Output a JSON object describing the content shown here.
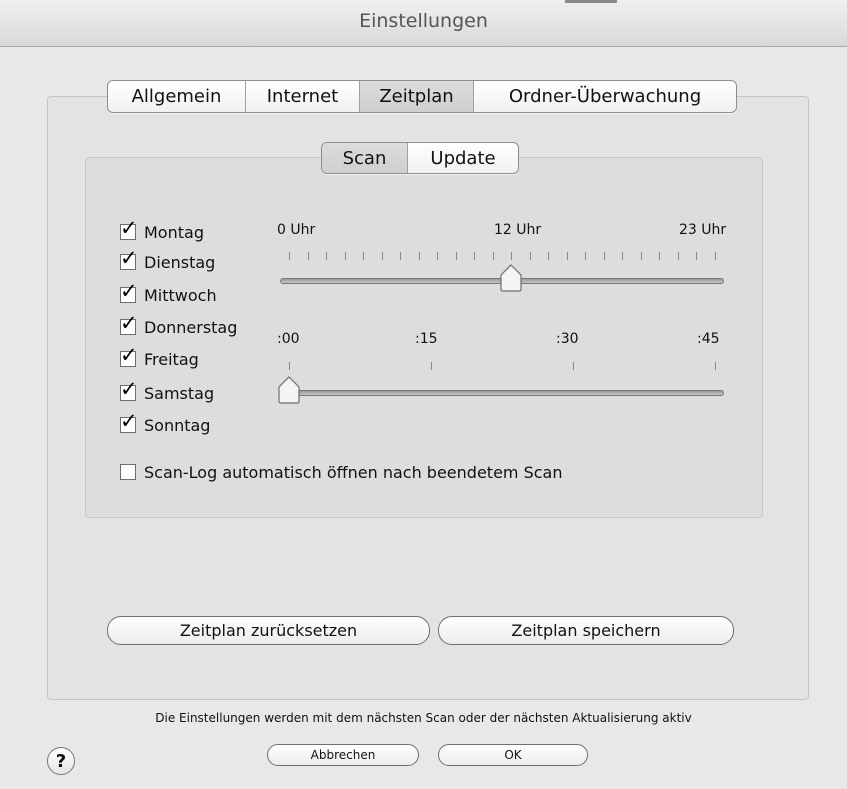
{
  "window": {
    "title": "Einstellungen"
  },
  "main_tabs": [
    {
      "label": "Allgemein",
      "selected": false
    },
    {
      "label": "Internet",
      "selected": false
    },
    {
      "label": "Zeitplan",
      "selected": true
    },
    {
      "label": "Ordner-Überwachung",
      "selected": false
    }
  ],
  "sub_tabs": [
    {
      "label": "Scan",
      "selected": true
    },
    {
      "label": "Update",
      "selected": false
    }
  ],
  "days": [
    {
      "label": "Montag",
      "checked": true
    },
    {
      "label": "Dienstag",
      "checked": true
    },
    {
      "label": "Mittwoch",
      "checked": true
    },
    {
      "label": "Donnerstag",
      "checked": true
    },
    {
      "label": "Freitag",
      "checked": true
    },
    {
      "label": "Samstag",
      "checked": true
    },
    {
      "label": "Sonntag",
      "checked": true
    }
  ],
  "hour_slider": {
    "labels": [
      "0 Uhr",
      "12 Uhr",
      "23 Uhr"
    ],
    "min": 0,
    "max": 23,
    "value": 12
  },
  "minute_slider": {
    "labels": [
      ":00",
      ":15",
      ":30",
      ":45"
    ],
    "min": 0,
    "max": 45,
    "value": 0
  },
  "scan_log": {
    "label": "Scan-Log automatisch öffnen nach beendetem Scan",
    "checked": false
  },
  "buttons": {
    "reset": "Zeitplan zurücksetzen",
    "save": "Zeitplan speichern",
    "cancel": "Abbrechen",
    "ok": "OK"
  },
  "footer": {
    "note": "Die Einstellungen werden mit dem nächsten Scan oder der nächsten Aktualisierung aktiv"
  },
  "help_symbol": "?",
  "check_mark": "✓"
}
